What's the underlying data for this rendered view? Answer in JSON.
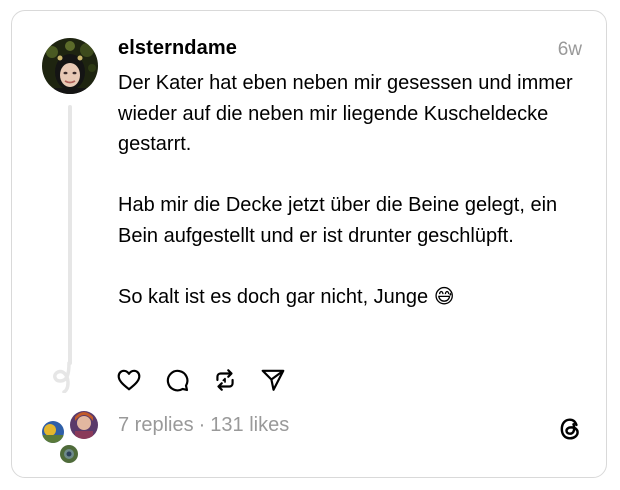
{
  "post": {
    "username": "elsterndame",
    "timestamp": "6w",
    "paragraphs": [
      "Der Kater hat eben neben mir gesessen und immer wieder auf die neben mir liegende Kuscheldecke gestarrt.",
      "Hab mir die Decke jetzt über die Beine gelegt, ein Bein aufgestellt und er ist drunter geschlüpft.",
      "So kalt ist es doch gar nicht, Junge 😅"
    ]
  },
  "actions": [
    {
      "name": "like",
      "icon": "heart-icon"
    },
    {
      "name": "reply",
      "icon": "comment-icon"
    },
    {
      "name": "repost",
      "icon": "repost-icon"
    },
    {
      "name": "share",
      "icon": "send-icon"
    }
  ],
  "stats": {
    "replies": "7 replies",
    "separator": "·",
    "likes": "131 likes"
  },
  "colors": {
    "text": "#000000",
    "muted": "#999999",
    "border": "#d9d9d9",
    "thread_line": "#e6e6e6"
  }
}
